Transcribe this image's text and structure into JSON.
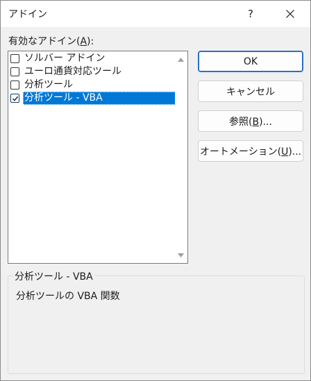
{
  "window": {
    "title": "アドイン",
    "help_label": "?",
    "close_icon": "close-icon"
  },
  "addins_list": {
    "label_prefix": "有効なアドイン(",
    "label_mnemonic": "A",
    "label_suffix": "):",
    "items": [
      {
        "label": "ソルバー アドイン",
        "checked": false,
        "selected": false
      },
      {
        "label": "ユーロ通貨対応ツール",
        "checked": false,
        "selected": false
      },
      {
        "label": "分析ツール",
        "checked": false,
        "selected": false
      },
      {
        "label": "分析ツール - VBA",
        "checked": true,
        "selected": true
      }
    ]
  },
  "buttons": {
    "ok_label": "OK",
    "cancel_label": "キャンセル",
    "browse_prefix": "参照(",
    "browse_mnemonic": "B",
    "browse_suffix": ")...",
    "automation_prefix": "オートメーション(",
    "automation_mnemonic": "U",
    "automation_suffix": ")..."
  },
  "description": {
    "group_title": "分析ツール - VBA",
    "text": "分析ツールの VBA 関数"
  },
  "colors": {
    "selection": "#0078d7",
    "default_button_border": "#2a6fc9",
    "dialog_background": "#f0f0f0"
  }
}
